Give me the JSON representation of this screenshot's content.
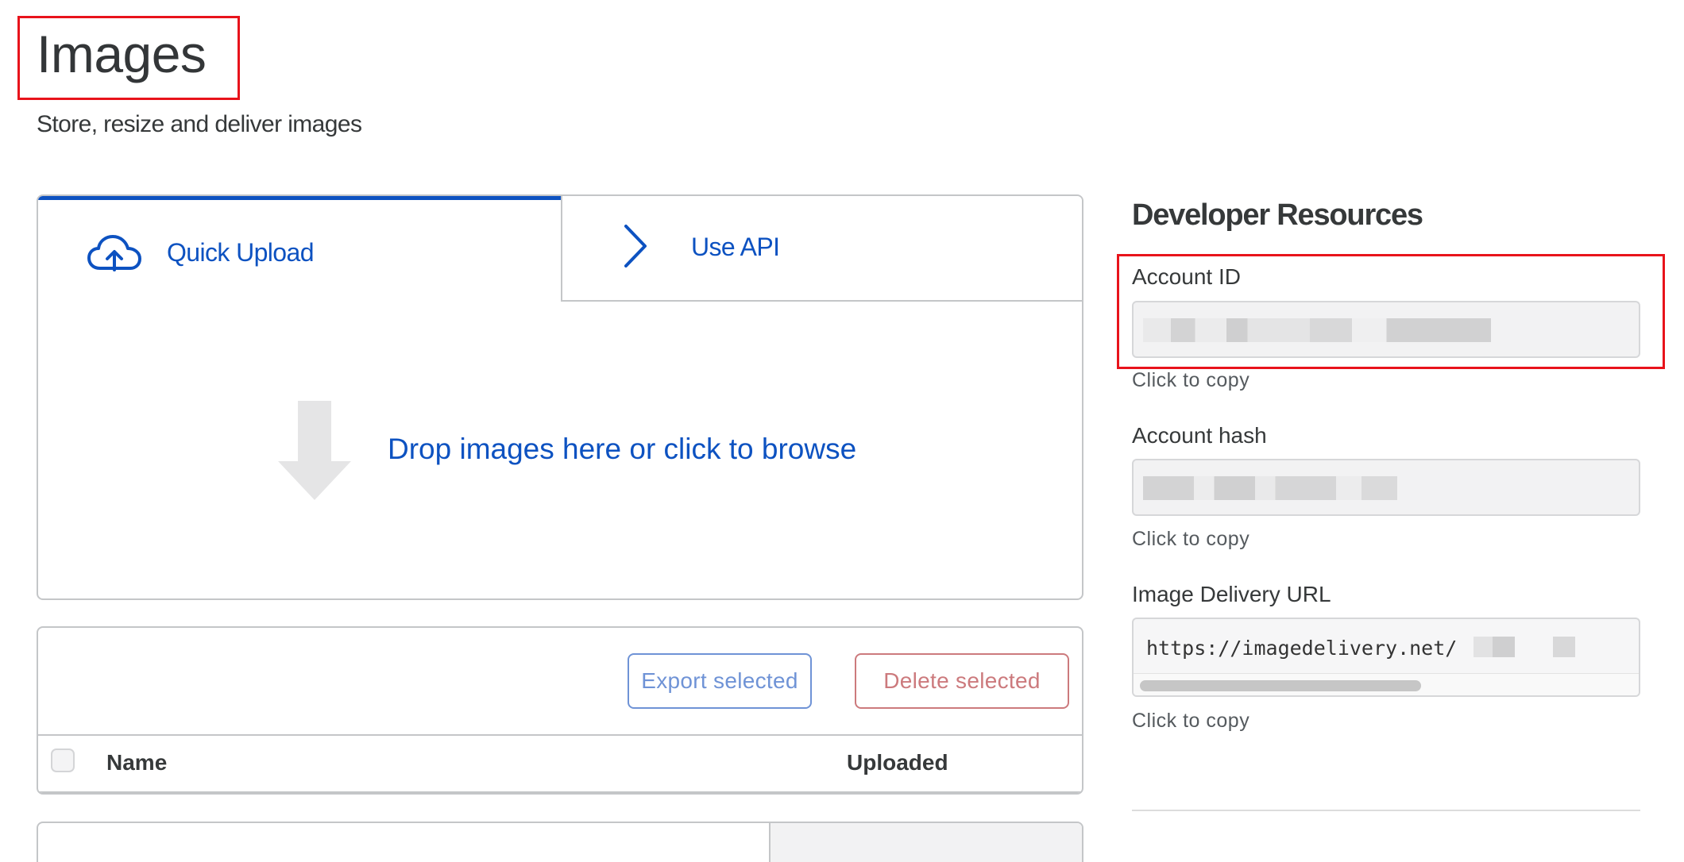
{
  "header": {
    "title": "Images",
    "subtitle": "Store, resize and deliver images"
  },
  "upload": {
    "tabs": [
      {
        "label": "Quick Upload",
        "icon": "cloud-upload-icon",
        "active": true
      },
      {
        "label": "Use API",
        "icon": "chevron-right-icon",
        "active": false
      }
    ],
    "drop_text": "Drop images here or click to browse",
    "drop_icon": "arrow-down-icon"
  },
  "table": {
    "export_label": "Export selected",
    "delete_label": "Delete selected",
    "columns": [
      "Name",
      "Uploaded"
    ]
  },
  "developer": {
    "heading": "Developer Resources",
    "account_id": {
      "label": "Account ID",
      "value": "",
      "hint": "Click to copy"
    },
    "account_hash": {
      "label": "Account hash",
      "value": "",
      "hint": "Click to copy"
    },
    "delivery_url": {
      "label": "Image Delivery URL",
      "value": "https://imagedelivery.net/",
      "hint": "Click to copy"
    }
  },
  "colors": {
    "accent": "#0d52c1",
    "highlight": "#e8131b",
    "danger_muted": "#cc7a7d",
    "accent_muted": "#6f93d6"
  }
}
